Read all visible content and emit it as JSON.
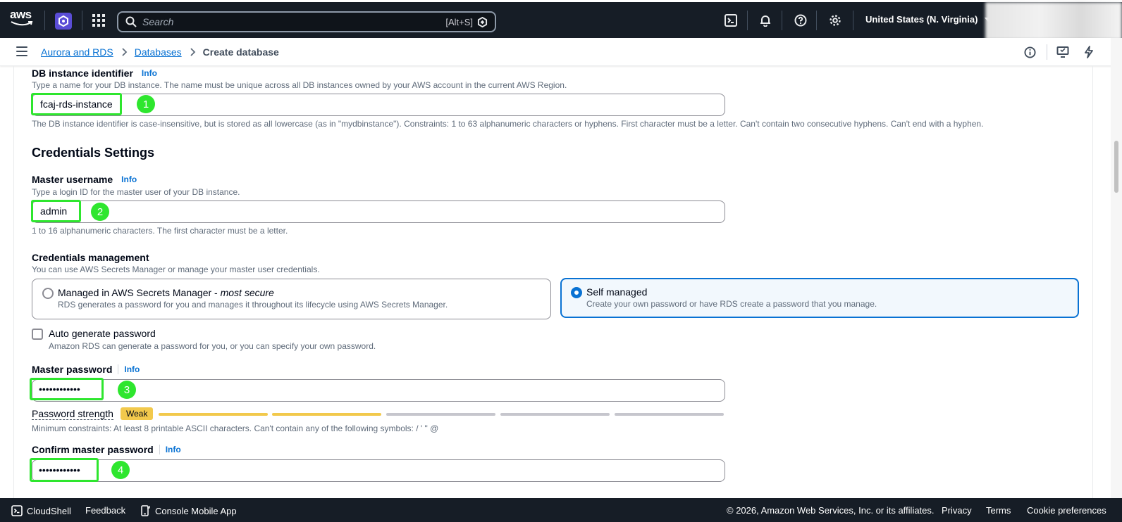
{
  "topnav": {
    "logo": "aws",
    "search_placeholder": "Search",
    "search_shortcut": "[Alt+S]",
    "region": "United States (N. Virginia)"
  },
  "breadcrumb": {
    "items": [
      "Aurora and RDS",
      "Databases"
    ],
    "current": "Create database"
  },
  "form": {
    "db_identifier": {
      "label": "DB instance identifier",
      "info": "Info",
      "description": "Type a name for your DB instance. The name must be unique across all DB instances owned by your AWS account in the current AWS Region.",
      "value": "fcaj-rds-instance",
      "help": "The DB instance identifier is case-insensitive, but is stored as all lowercase (as in \"mydbinstance\"). Constraints: 1 to 63 alphanumeric characters or hyphens. First character must be a letter. Can't contain two consecutive hyphens. Can't end with a hyphen.",
      "badge": "1"
    },
    "credentials_heading": "Credentials Settings",
    "master_username": {
      "label": "Master username",
      "info": "Info",
      "description": "Type a login ID for the master user of your DB instance.",
      "value": "admin",
      "help": "1 to 16 alphanumeric characters. The first character must be a letter.",
      "badge": "2"
    },
    "credentials_management": {
      "label": "Credentials management",
      "description": "You can use AWS Secrets Manager or manage your master user credentials.",
      "options": [
        {
          "title": "Managed in AWS Secrets Manager - ",
          "title_em": "most secure",
          "desc": "RDS generates a password for you and manages it throughout its lifecycle using AWS Secrets Manager.",
          "selected": false
        },
        {
          "title": "Self managed",
          "title_em": "",
          "desc": "Create your own password or have RDS create a password that you manage.",
          "selected": true
        }
      ]
    },
    "auto_generate": {
      "label": "Auto generate password",
      "description": "Amazon RDS can generate a password for you, or you can specify your own password.",
      "checked": false
    },
    "master_password": {
      "label": "Master password",
      "info": "Info",
      "value": "••••••••••••",
      "badge": "3",
      "strength_label": "Password strength",
      "strength_text": "Weak",
      "strength_level": 0.4,
      "constraints": "Minimum constraints: At least 8 printable ASCII characters. Can't contain any of the following symbols: / ' \" @"
    },
    "confirm_password": {
      "label": "Confirm master password",
      "info": "Info",
      "value": "••••••••••••",
      "badge": "4"
    }
  },
  "footer": {
    "cloudshell": "CloudShell",
    "feedback": "Feedback",
    "mobile_app": "Console Mobile App",
    "copyright": "© 2026, Amazon Web Services, Inc. or its affiliates.",
    "privacy": "Privacy",
    "terms": "Terms",
    "cookies": "Cookie preferences"
  },
  "colors": {
    "nav_bg": "#161d26",
    "link": "#0972d3",
    "highlight": "#2ee62e",
    "weak": "#f2c94c"
  }
}
